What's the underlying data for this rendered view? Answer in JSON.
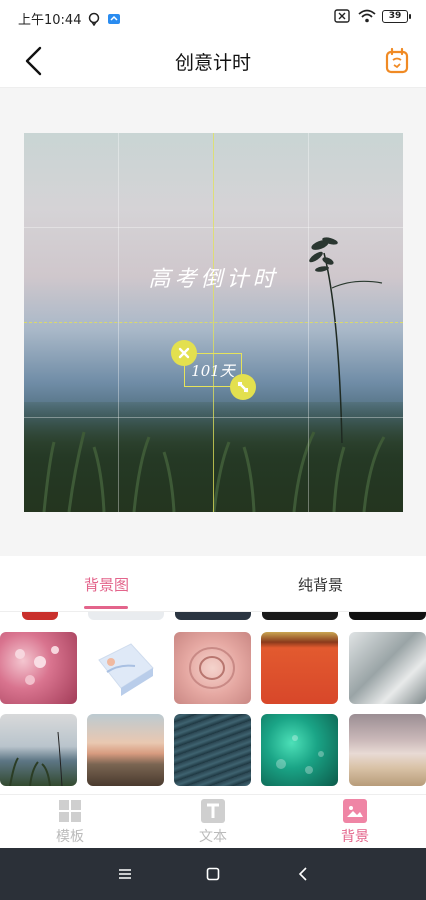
{
  "status_bar": {
    "time": "上午10:44",
    "battery": "39"
  },
  "header": {
    "title": "创意计时"
  },
  "preview": {
    "title": "高考倒计时",
    "days": "101天"
  },
  "tabs": [
    {
      "label": "背景图",
      "active": true
    },
    {
      "label": "纯背景",
      "active": false
    }
  ],
  "bottom_nav": [
    {
      "label": "模板",
      "icon": "template-icon",
      "active": false
    },
    {
      "label": "文本",
      "icon": "text-icon",
      "active": false
    },
    {
      "label": "背景",
      "icon": "image-icon",
      "active": true
    }
  ],
  "colors": {
    "accent": "#e3648b",
    "handle": "#e3e04f",
    "title_orange": "#f08a24"
  },
  "system_nav": {
    "icons": [
      "menu-icon",
      "home-icon",
      "back-icon"
    ]
  }
}
